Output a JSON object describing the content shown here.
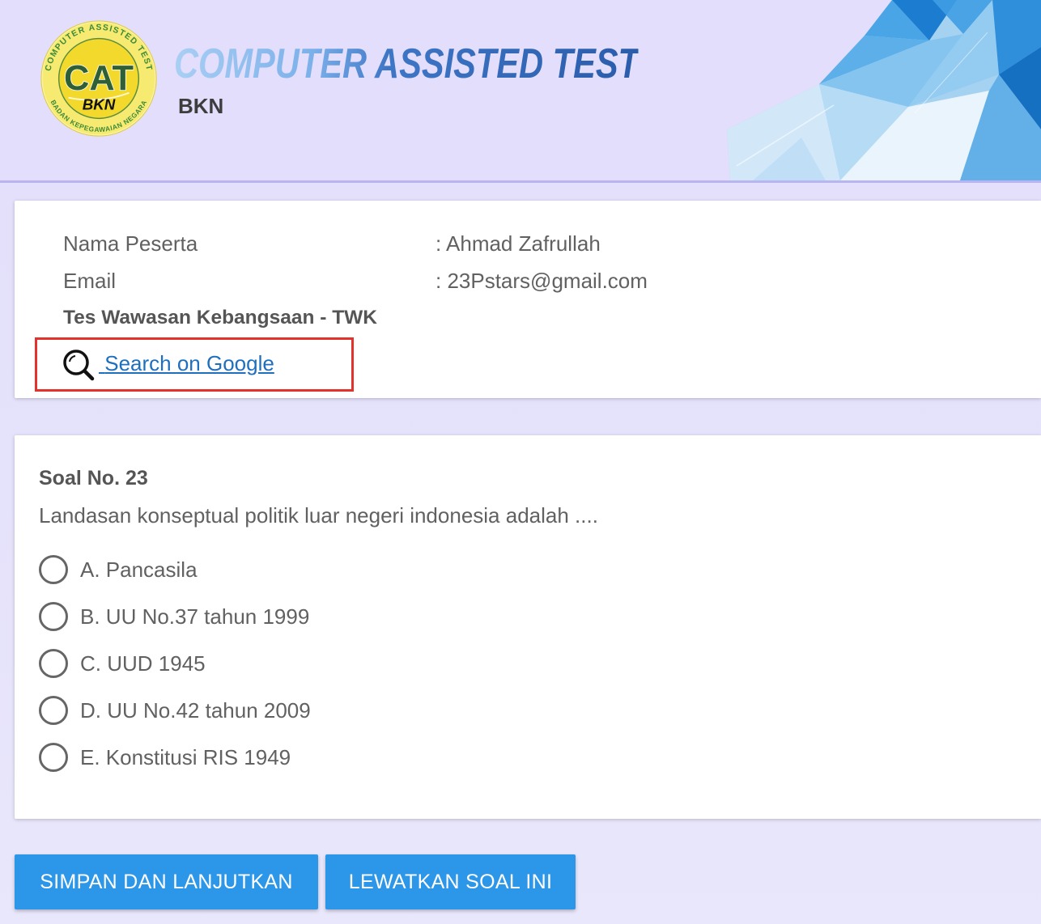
{
  "header": {
    "logo": {
      "ring_top": "COMPUTER ASSISTED TEST",
      "ring_bottom": "BADAN KEPEGAWAIAN NEGARA",
      "center": "CAT",
      "sub": "BKN"
    },
    "title": "COMPUTER ASSISTED TEST",
    "subtitle": "BKN"
  },
  "participant": {
    "name_label": "Nama Peserta",
    "name_value": ": Ahmad Zafrullah",
    "email_label": "Email",
    "email_value": ": 23Pstars@gmail.com",
    "test_title": "Tes Wawasan Kebangsaan - TWK",
    "search_link": "Search on Google"
  },
  "question": {
    "heading": "Soal No. 23",
    "text": "Landasan konseptual politik luar negeri indonesia adalah ....",
    "options": [
      {
        "label": "A. Pancasila",
        "selected": false
      },
      {
        "label": "B. UU No.37 tahun 1999",
        "selected": false
      },
      {
        "label": "C. UUD 1945",
        "selected": false
      },
      {
        "label": "D. UU No.42 tahun 2009",
        "selected": false
      },
      {
        "label": "E. Konstitusi RIS 1949",
        "selected": false
      }
    ]
  },
  "actions": {
    "save_label": "SIMPAN DAN LANJUTKAN",
    "skip_label": "LEWATKAN SOAL INI"
  },
  "icons": {
    "search": "magnifier-icon",
    "option": "radio-unchecked-icon"
  },
  "colors": {
    "accent": "#2c96e9",
    "link": "#1f6fbf",
    "highlight": "#e3322b",
    "background": "#e3dffb",
    "text": "#616161"
  }
}
